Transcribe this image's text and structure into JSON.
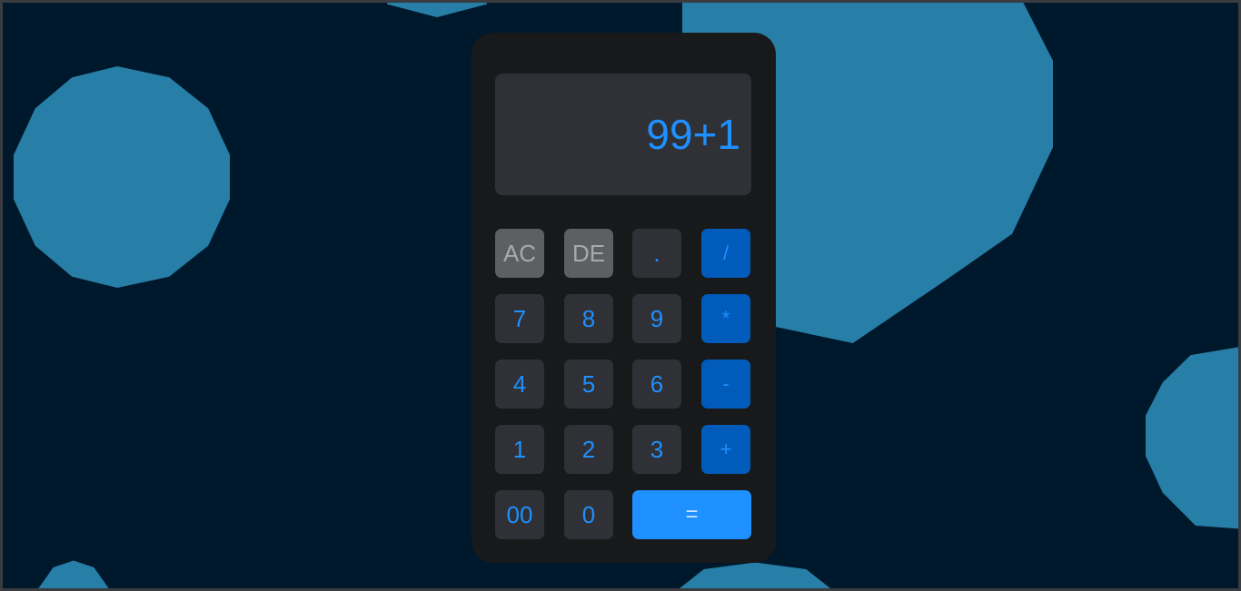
{
  "calculator": {
    "display": "99+1",
    "keys": {
      "ac": "AC",
      "de": "DE",
      "dot": ".",
      "divide": "/",
      "seven": "7",
      "eight": "8",
      "nine": "9",
      "multiply": "*",
      "four": "4",
      "five": "5",
      "six": "6",
      "subtract": "-",
      "one": "1",
      "two": "2",
      "three": "3",
      "add": "+",
      "double_zero": "00",
      "zero": "0",
      "equals": "="
    }
  },
  "colors": {
    "background": "#00182b",
    "blob": "#277ea7",
    "calculator_body": "#18191b",
    "display_bg": "#2f3136",
    "accent": "#1e90ff",
    "operator_key": "#005bbb",
    "function_key": "#5e5f61"
  }
}
